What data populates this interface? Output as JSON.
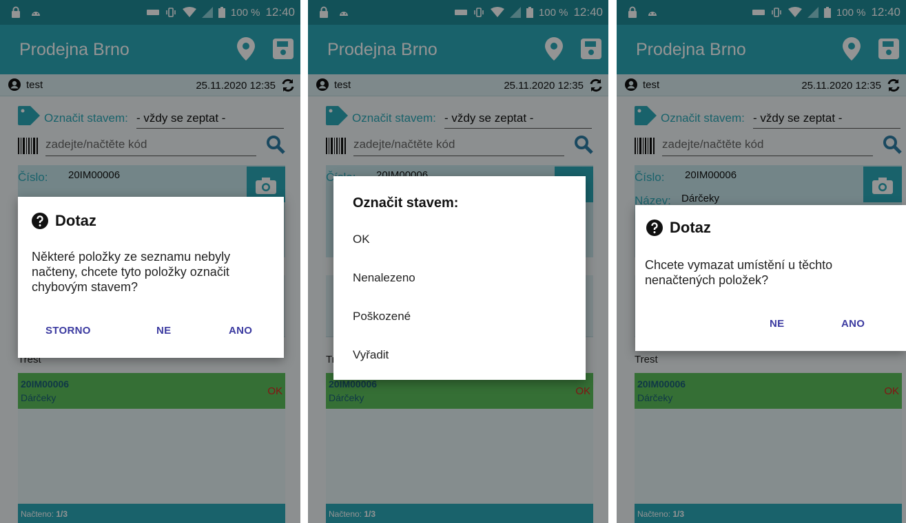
{
  "status_bar": {
    "battery": "100 %",
    "time": "12:40"
  },
  "app": {
    "title": "Prodejna Brno"
  },
  "user": {
    "name": "test",
    "datetime": "25.11.2020 12:35"
  },
  "form": {
    "status_label": "Označit stavem:",
    "status_value": "- vždy se zeptat -",
    "code_placeholder": "zadejte/načtěte kód"
  },
  "info": {
    "number_label": "Číslo:",
    "number_value": "20IM00006",
    "name_label": "Název:",
    "name_value": "Dárčeky"
  },
  "list": {
    "group": "Trest",
    "items": [
      {
        "code": "20IM00006",
        "name": "Dárčeky",
        "state": "OK"
      }
    ]
  },
  "footer": {
    "label": "Načteno:",
    "value": "1/3"
  },
  "dialog1": {
    "title": "Dotaz",
    "message": "Některé položky ze seznamu nebyly načteny, chcete tyto položky označit chybovým stavem?",
    "storno": "STORNO",
    "ne": "NE",
    "ano": "ANO"
  },
  "dialog2": {
    "title": "Označit stavem:",
    "options": [
      "OK",
      "Nenalezeno",
      "Poškozené",
      "Vyřadit"
    ]
  },
  "dialog3": {
    "title": "Dotaz",
    "message": "Chcete vymazat umístění u těchto nenačtených položek?",
    "ne": "NE",
    "ano": "ANO"
  },
  "colors": {
    "primary": "#2ba9b8",
    "status_bar": "#1f8c98",
    "ok_row": "#5cc05c",
    "button_text": "#3b3aa0",
    "error_text": "#e32121"
  }
}
